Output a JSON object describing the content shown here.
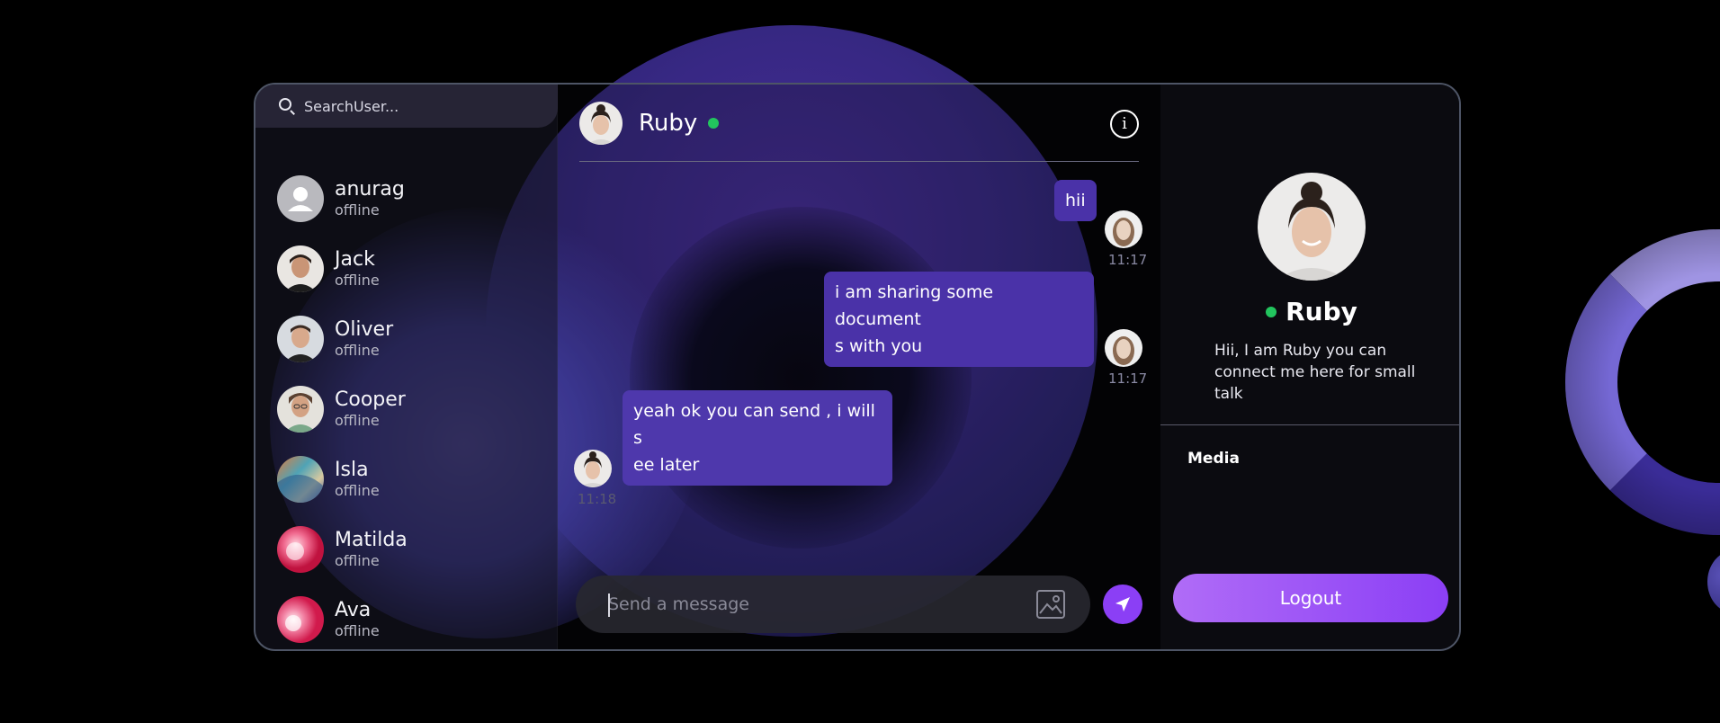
{
  "search": {
    "placeholder": "SearchUser..."
  },
  "users": [
    {
      "name": "anurag",
      "status": "offline"
    },
    {
      "name": "Jack",
      "status": "offline"
    },
    {
      "name": "Oliver",
      "status": "offline"
    },
    {
      "name": "Cooper",
      "status": "offline"
    },
    {
      "name": "Isla",
      "status": "offline"
    },
    {
      "name": "Matilda",
      "status": "offline"
    },
    {
      "name": "Ava",
      "status": "offline"
    }
  ],
  "chat": {
    "contact_name": "Ruby",
    "info_icon": "info-icon",
    "messages": [
      {
        "text": "hii",
        "time": "11:17",
        "direction": "out"
      },
      {
        "text": "i am sharing some document\ns with you",
        "time": "11:17",
        "direction": "out"
      },
      {
        "text": "yeah ok you can send , i will s\nee later",
        "time": "11:18",
        "direction": "in"
      }
    ],
    "input_placeholder": "Send a message",
    "attach_icon": "image-icon",
    "send_icon": "send-icon"
  },
  "profile": {
    "name": "Ruby",
    "bio": "Hii, I am Ruby you can connect me here for small talk",
    "media_label": "Media",
    "logout_label": "Logout"
  },
  "colors": {
    "accent": "#8b3ff5",
    "online": "#22c55e",
    "bubble": "#4a32a8"
  }
}
